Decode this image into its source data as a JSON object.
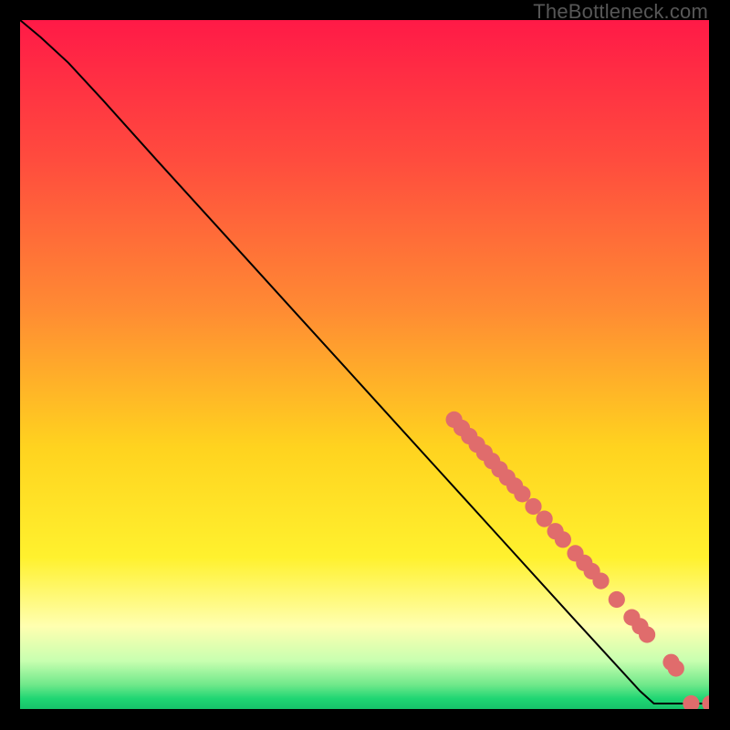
{
  "watermark": "TheBottleneck.com",
  "chart_data": {
    "type": "line",
    "title": "",
    "xlabel": "",
    "ylabel": "",
    "xlim": [
      0,
      100
    ],
    "ylim": [
      0,
      100
    ],
    "grid": false,
    "legend": false,
    "note": "Vertical gradient background from red (high y) through orange/yellow to a thin green band near y=0. Single black curve descending from top-left corner to bottom-right; salmon dots mark sampled points on the lower-right portion of the curve; the flat bottom segment touches the green band.",
    "background_gradient_stops": [
      {
        "offset": 0.0,
        "color": "#ff1a47"
      },
      {
        "offset": 0.2,
        "color": "#ff4b3e"
      },
      {
        "offset": 0.42,
        "color": "#ff8b33"
      },
      {
        "offset": 0.62,
        "color": "#ffd31f"
      },
      {
        "offset": 0.78,
        "color": "#fff12e"
      },
      {
        "offset": 0.88,
        "color": "#ffffb0"
      },
      {
        "offset": 0.93,
        "color": "#c8ffb0"
      },
      {
        "offset": 0.965,
        "color": "#6fe88a"
      },
      {
        "offset": 0.985,
        "color": "#1fd673"
      },
      {
        "offset": 1.0,
        "color": "#17c36a"
      }
    ],
    "series": [
      {
        "name": "curve",
        "type": "line",
        "color": "#000000",
        "points": [
          {
            "x": 0,
            "y": 100
          },
          {
            "x": 3,
            "y": 97.5
          },
          {
            "x": 7,
            "y": 93.8
          },
          {
            "x": 12,
            "y": 88.4
          },
          {
            "x": 20,
            "y": 79.5
          },
          {
            "x": 30,
            "y": 68.5
          },
          {
            "x": 40,
            "y": 57.5
          },
          {
            "x": 50,
            "y": 46.5
          },
          {
            "x": 60,
            "y": 35.5
          },
          {
            "x": 70,
            "y": 24.5
          },
          {
            "x": 80,
            "y": 13.5
          },
          {
            "x": 90,
            "y": 2.6
          },
          {
            "x": 92,
            "y": 0.8
          },
          {
            "x": 96,
            "y": 0.8
          },
          {
            "x": 99,
            "y": 0.8
          }
        ]
      },
      {
        "name": "dots",
        "type": "scatter",
        "color": "#e06c6c",
        "radius_pct": 1.2,
        "points": [
          {
            "x": 63.0,
            "y": 42.0
          },
          {
            "x": 64.1,
            "y": 40.8
          },
          {
            "x": 65.2,
            "y": 39.6
          },
          {
            "x": 66.3,
            "y": 38.4
          },
          {
            "x": 67.4,
            "y": 37.2
          },
          {
            "x": 68.5,
            "y": 36.0
          },
          {
            "x": 69.6,
            "y": 34.8
          },
          {
            "x": 70.7,
            "y": 33.6
          },
          {
            "x": 71.8,
            "y": 32.4
          },
          {
            "x": 72.9,
            "y": 31.2
          },
          {
            "x": 74.5,
            "y": 29.4
          },
          {
            "x": 76.1,
            "y": 27.6
          },
          {
            "x": 77.7,
            "y": 25.8
          },
          {
            "x": 78.8,
            "y": 24.6
          },
          {
            "x": 80.6,
            "y": 22.6
          },
          {
            "x": 81.9,
            "y": 21.2
          },
          {
            "x": 83.0,
            "y": 20.0
          },
          {
            "x": 84.3,
            "y": 18.6
          },
          {
            "x": 86.6,
            "y": 15.9
          },
          {
            "x": 88.8,
            "y": 13.3
          },
          {
            "x": 90.0,
            "y": 12.0
          },
          {
            "x": 91.0,
            "y": 10.8
          },
          {
            "x": 94.5,
            "y": 6.8
          },
          {
            "x": 95.2,
            "y": 5.9
          },
          {
            "x": 97.4,
            "y": 0.8
          },
          {
            "x": 100.2,
            "y": 0.8
          },
          {
            "x": 101.4,
            "y": 0.8
          }
        ]
      }
    ]
  }
}
